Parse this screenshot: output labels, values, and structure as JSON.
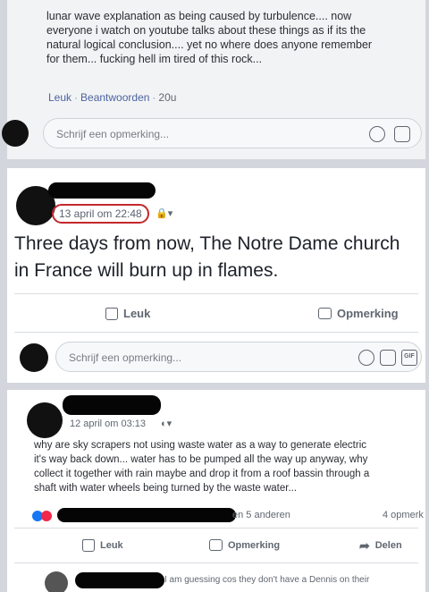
{
  "top_card": {
    "lines": [
      "lunar wave explanation as being caused by turbulence.... now",
      "everyone i watch on youtube talks about these things as if its the",
      "natural logical conclusion.... yet no where does anyone remember",
      "for them... fucking hell im tired of this rock..."
    ],
    "like_label": "Leuk",
    "reply_label": "Beantwoorden",
    "age": "20u",
    "comment_placeholder": "Schrijf een opmerking..."
  },
  "post": {
    "timestamp": "13 april om 22:48",
    "privacy_icon": "lock-icon",
    "text": "Three days from now, The Notre Dame church in France will burn up in flames.",
    "like_label": "Leuk",
    "comment_label": "Opmerking",
    "comment_placeholder": "Schrijf een opmerking..."
  },
  "third_post": {
    "timestamp": "12 april om 03:13",
    "lines": [
      "why are sky scrapers not using waste water as a way to generate electric",
      "it's way back down... water has to be pumped all the way up anyway, why",
      "collect it together with rain maybe and drop it from a roof bassin through a",
      "shaft with water wheels being turned by the waste water..."
    ],
    "reactions_text": "en 5 anderen",
    "comments_count": "4 opmerk",
    "like_label": "Leuk",
    "comment_label": "Opmerking",
    "share_label": "Delen",
    "partial_comment": "I am guessing cos they don't have a Dennis on their"
  },
  "colors": {
    "link": "#4b63a0",
    "circle": "#c3282d",
    "like_blue": "#1877f2",
    "angry_red": "#f0284a"
  }
}
